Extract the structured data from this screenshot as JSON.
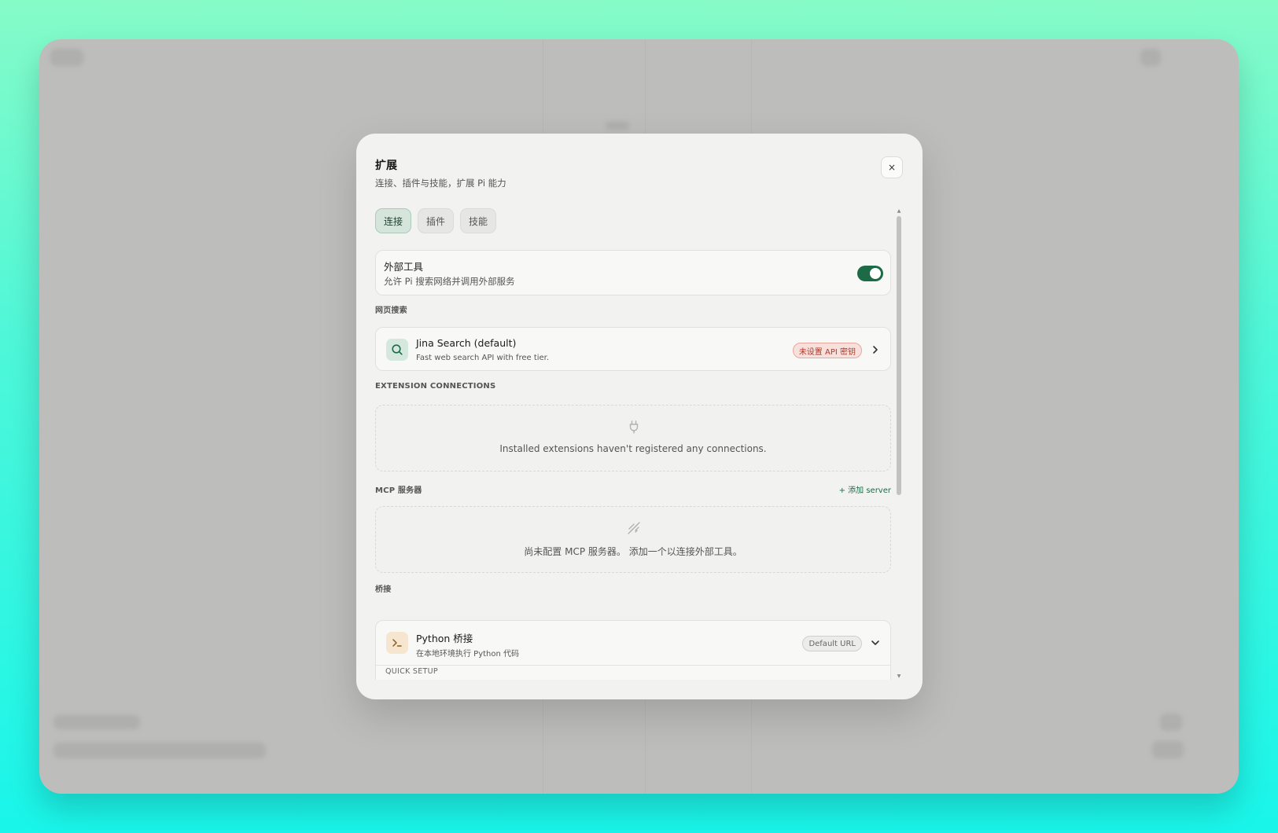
{
  "modal": {
    "title": "扩展",
    "subtitle": "连接、插件与技能，扩展 Pi 能力",
    "close": "×"
  },
  "tabs": [
    {
      "label": "连接",
      "active": true
    },
    {
      "label": "插件",
      "active": false
    },
    {
      "label": "技能",
      "active": false
    }
  ],
  "external_tools": {
    "title": "外部工具",
    "description": "允许 Pi 搜索网络并调用外部服务",
    "enabled": true
  },
  "web_search": {
    "section_label": "网页搜索",
    "provider": {
      "name": "Jina Search (default)",
      "description": "Fast web search API with free tier.",
      "badge": "未设置 API 密钥",
      "icon": "search-icon"
    }
  },
  "extension_connections": {
    "section_label": "EXTENSION CONNECTIONS",
    "empty_text": "Installed extensions haven't registered any connections.",
    "icon": "plug-icon"
  },
  "mcp": {
    "section_label": "MCP 服务器",
    "add_label": "+ 添加 server",
    "empty_text": "尚未配置 MCP 服务器。 添加一个以连接外部工具。",
    "icon": "unplugged-icon"
  },
  "bridge": {
    "section_label": "桥接",
    "item": {
      "name": "Python 桥接",
      "description": "在本地环境执行 Python 代码",
      "badge": "Default URL",
      "icon": "terminal-icon"
    },
    "quick_setup_label": "QUICK SETUP"
  },
  "colors": {
    "accent": "#1d6b46",
    "warning": "#b03a2a",
    "modal_bg": "#f2f2f0",
    "backdrop": "#bdbdbb"
  }
}
